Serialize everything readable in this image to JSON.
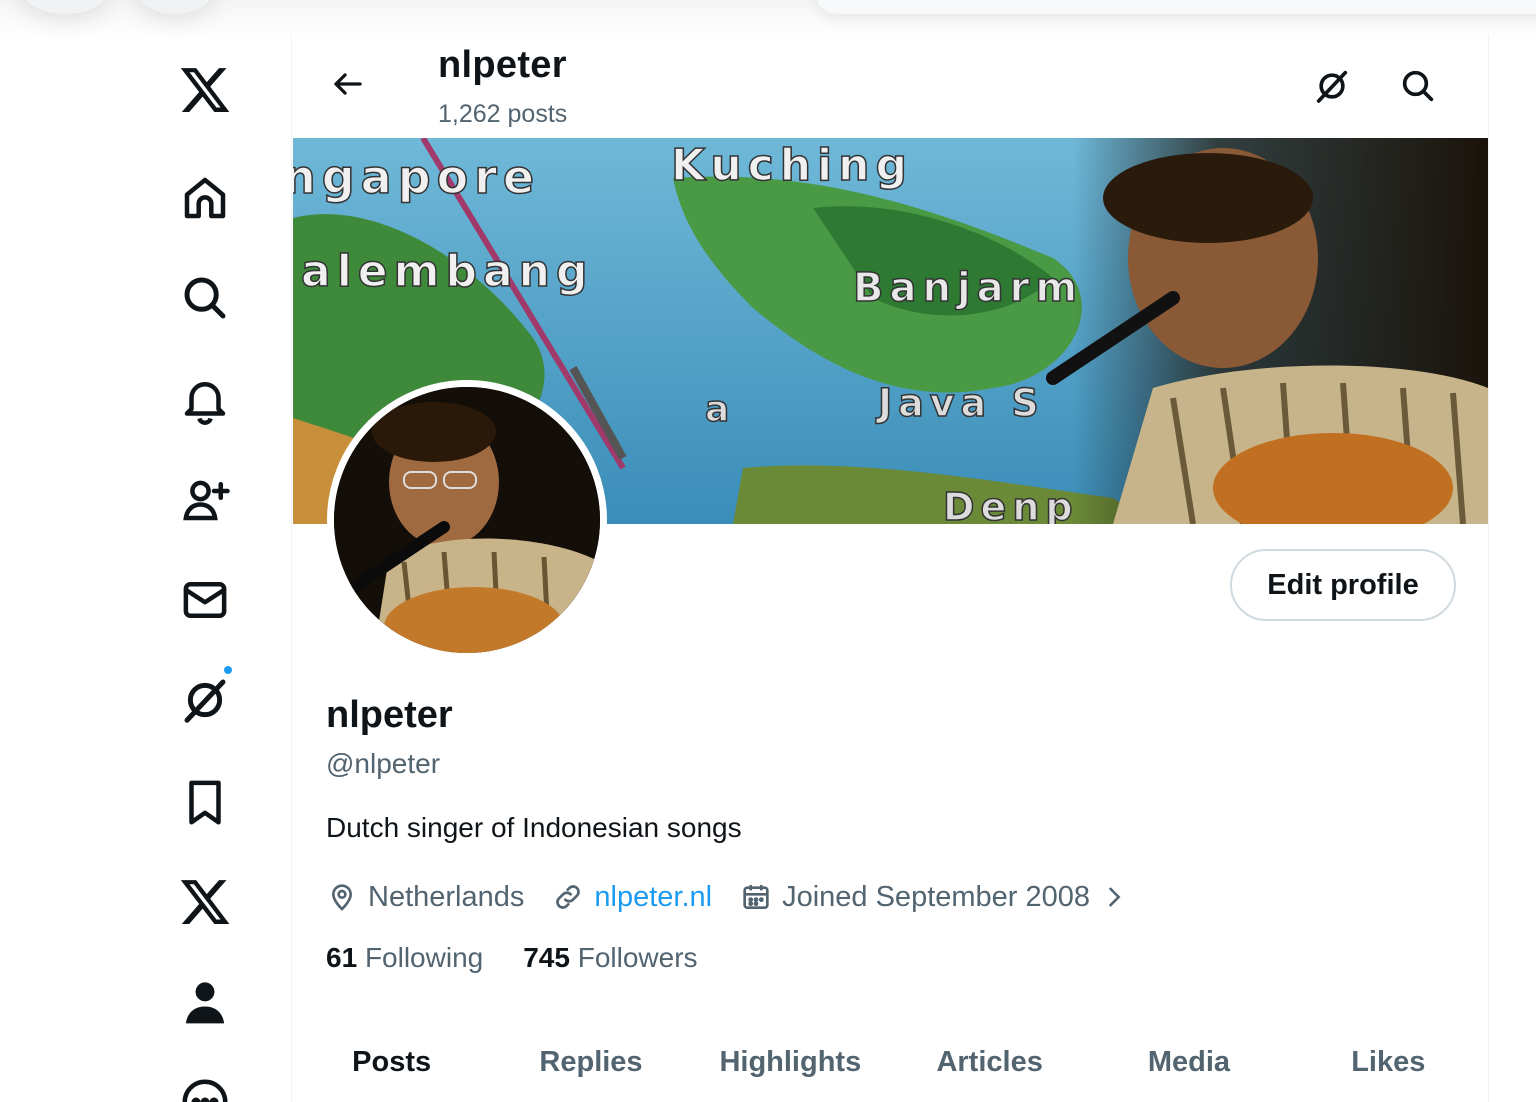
{
  "header": {
    "name": "nlpeter",
    "posts_count": "1,262 posts"
  },
  "profile": {
    "name": "nlpeter",
    "handle": "@nlpeter",
    "bio": "Dutch singer of Indonesian songs",
    "location": "Netherlands",
    "website": "nlpeter.nl",
    "joined": "Joined September 2008",
    "following_count": "61",
    "following_label": "Following",
    "followers_count": "745",
    "followers_label": "Followers",
    "edit_profile_label": "Edit profile"
  },
  "banner": {
    "map_labels": [
      "ngapore",
      "Kuching",
      "alembang",
      "Banjarm",
      "Java S",
      "a",
      "Denp"
    ]
  },
  "tabs": [
    "Posts",
    "Replies",
    "Highlights",
    "Articles",
    "Media",
    "Likes"
  ],
  "active_tab": "Posts",
  "nav": {
    "items": [
      "x-logo-icon",
      "home-icon",
      "explore-icon",
      "notifications-icon",
      "follow-icon",
      "messages-icon",
      "grok-icon",
      "bookmarks-icon",
      "premium-x-icon",
      "profile-icon",
      "more-icon"
    ]
  },
  "colors": {
    "accent": "#1d9bf0",
    "text": "#0f1419",
    "secondary": "#536471"
  }
}
